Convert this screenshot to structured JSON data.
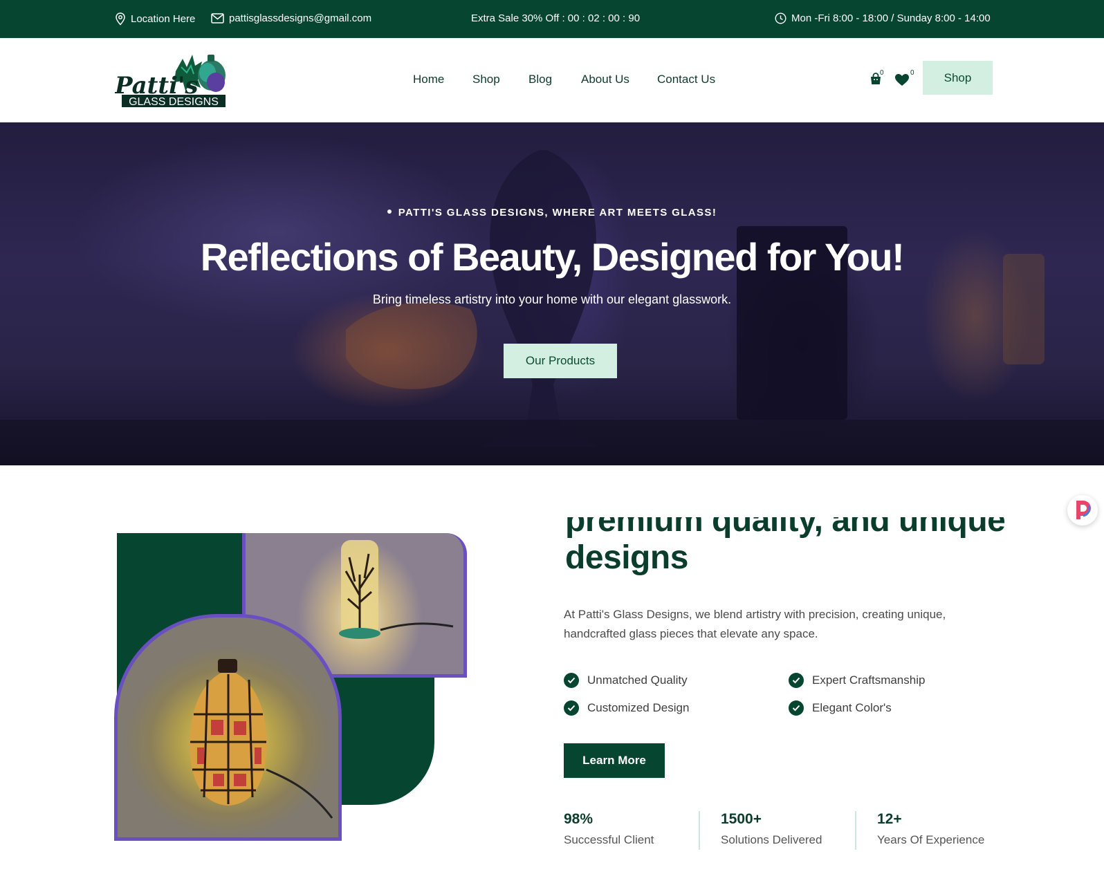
{
  "topbar": {
    "location": "Location Here",
    "email": "pattisglassdesigns@gmail.com",
    "sale": "Extra Sale 30% Off : 00 : 02 : 00 : 90",
    "hours": "Mon -Fri 8:00 - 18:00 / Sunday 8:00 - 14:00"
  },
  "logo": {
    "script_text": "Patti's",
    "caption": "GLASS DESIGNS"
  },
  "nav": {
    "items": [
      "Home",
      "Shop",
      "Blog",
      "About Us",
      "Contact Us"
    ]
  },
  "header": {
    "cart_count": "0",
    "wishlist_count": "0",
    "shop_label": "Shop"
  },
  "hero": {
    "tagline": "PATTI'S GLASS DESIGNS, WHERE ART MEETS GLASS!",
    "title": "Reflections of Beauty, Designed for You!",
    "subtitle": "Bring timeless artistry into your home with our elegant glasswork.",
    "button": "Our Products"
  },
  "about": {
    "title_line1": "premium quality, and unique",
    "title_line2": "designs",
    "text": "At Patti's Glass Designs, we blend artistry with precision, creating unique, handcrafted glass pieces that elevate any space.",
    "features": [
      "Unmatched Quality",
      "Expert Craftsmanship",
      "Customized Design",
      "Elegant Color's"
    ],
    "button": "Learn More",
    "stats": [
      {
        "value": "98%",
        "label": "Successful Client"
      },
      {
        "value": "1500+",
        "label": "Solutions Delivered"
      },
      {
        "value": "12+",
        "label": "Years Of Experience"
      }
    ]
  },
  "colors": {
    "brand_green": "#064630",
    "mint": "#d3efe2",
    "frame_purple": "#6a4fc0"
  }
}
